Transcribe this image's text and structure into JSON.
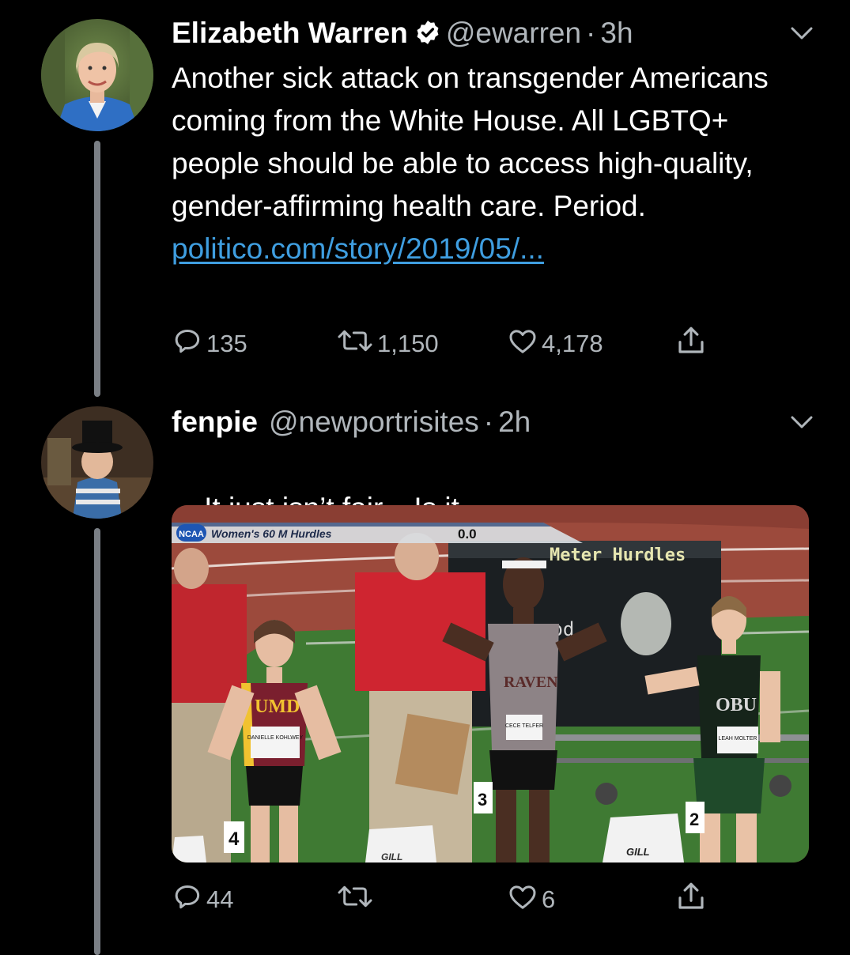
{
  "tweet1": {
    "name": "Elizabeth Warren",
    "handle": "@ewarren",
    "separator": "·",
    "time": "3h",
    "text": "Another sick attack on transgender Americans coming from the White House. All LGBTQ+ people should be able to access high-quality, gender-affirming health care. Period.",
    "link": "politico.com/story/2019/05/...",
    "reply_count": "135",
    "retweet_count": "1,150",
    "like_count": "4,178"
  },
  "tweet2": {
    "name": "fenpie",
    "handle": "@newportrisites",
    "separator": "·",
    "time": "2h",
    "text": "It just isn’t fair.   Is it",
    "reply_count": "44",
    "like_count": "6",
    "media": {
      "ncaa_logo": "NCAA",
      "event_title": "Women's 60 M Hurdles",
      "clock": "0.0",
      "scoreboard_text": "Meter Hurdles",
      "scoreboard_text2": "ood",
      "bib_4": "DANIELLE KOHLWEY",
      "bib_3": "CECE TELFER",
      "bib_2": "LEAH MOLTER",
      "jersey_umd": "UMD",
      "jersey_raven": "RAVEN",
      "jersey_obu": "OBU",
      "lane_4": "4",
      "lane_3": "3",
      "lane_2": "2",
      "block_brand": "GILL",
      "block_brand_2": "GILL"
    }
  },
  "colors": {
    "background": "#000000",
    "text": "#ffffff",
    "secondary": "#b0b6bb",
    "link": "#3f9ee0",
    "thread_line": "#7a7f85"
  },
  "icons": [
    "verified-badge-icon",
    "chevron-down-icon",
    "reply-icon",
    "retweet-icon",
    "like-icon",
    "share-icon"
  ]
}
